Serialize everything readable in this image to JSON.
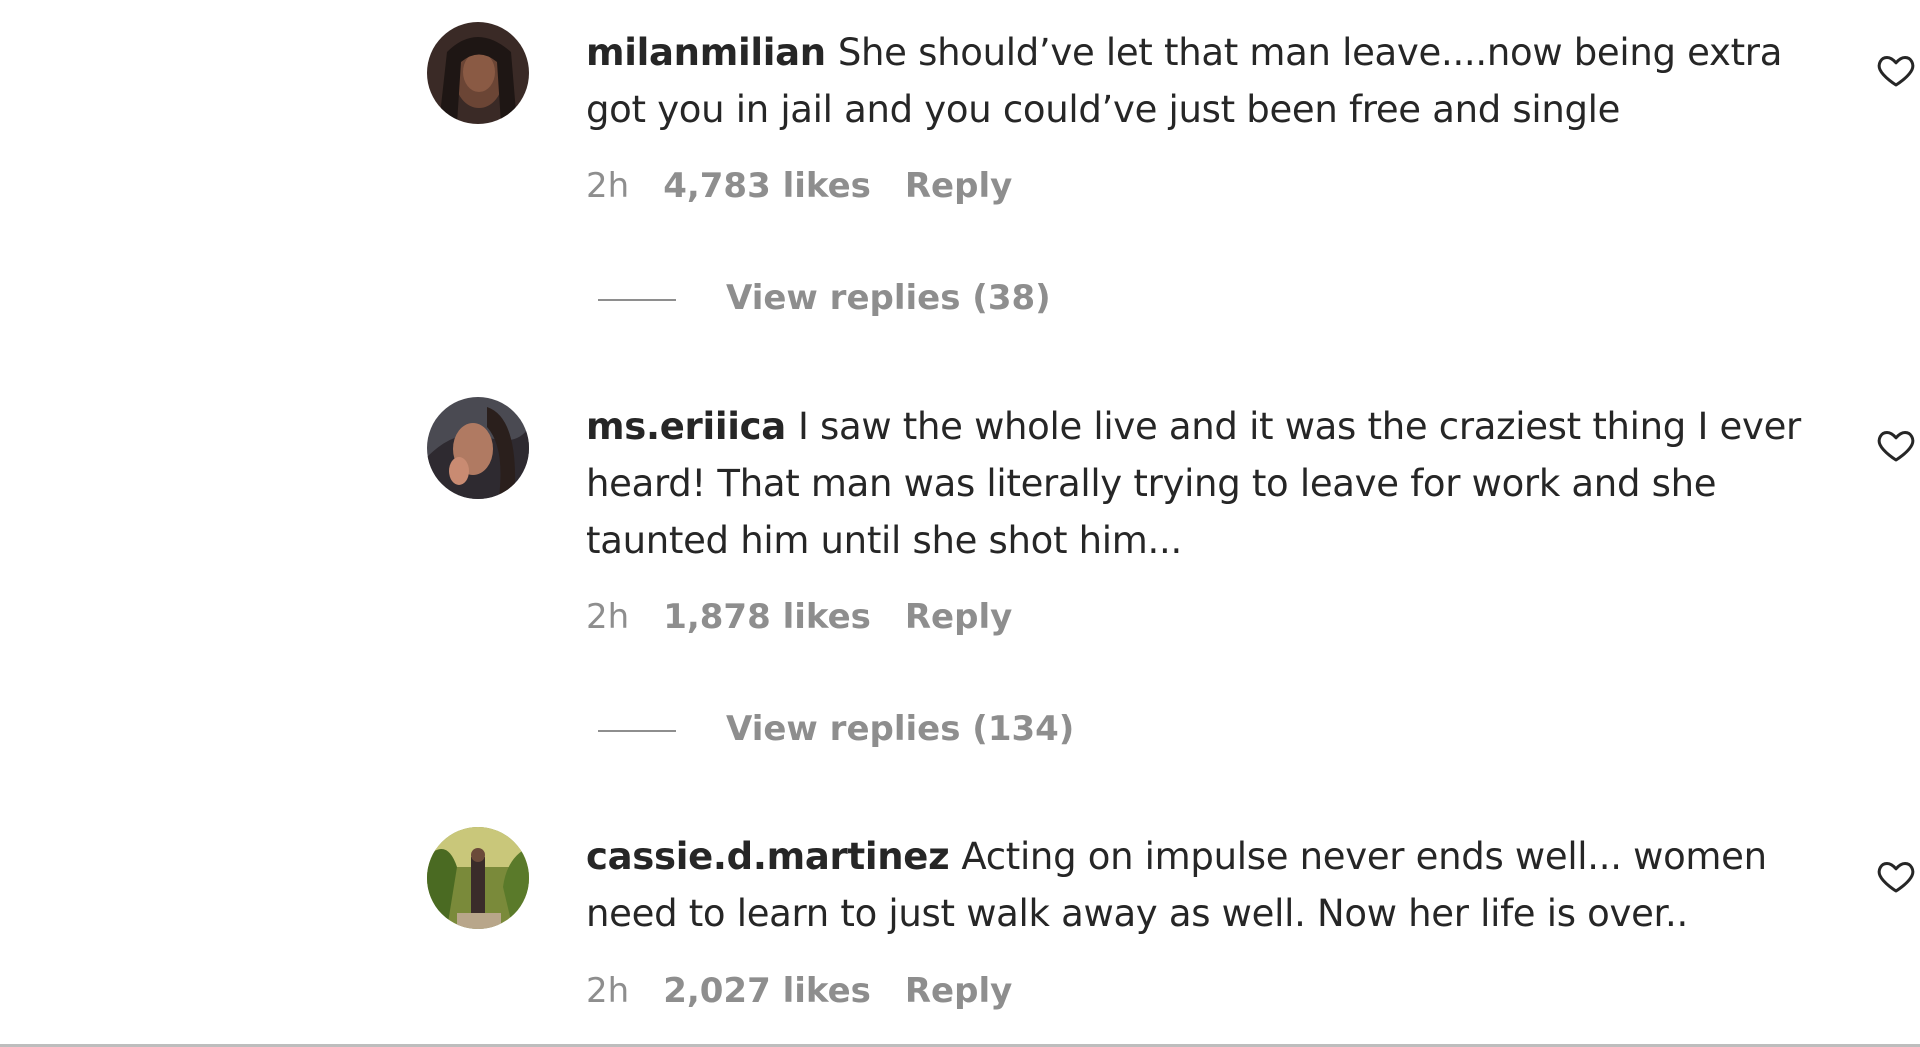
{
  "comments": [
    {
      "username": "milanmilian",
      "text": "She should’ve let that man leave....now being extra got you in jail and you could’ve just been free and single",
      "time": "2h",
      "likes": "4,783 likes",
      "reply": "Reply",
      "view_replies": "View replies (38)"
    },
    {
      "username": "ms.eriiica",
      "text": "I saw the whole live and it was the craziest thing I ever heard! That man was literally trying to leave for work and she taunted him until she shot him...",
      "time": "2h",
      "likes": "1,878 likes",
      "reply": "Reply",
      "view_replies": "View replies (134)"
    },
    {
      "username": "cassie.d.martinez",
      "text": "Acting on impulse never ends well... women need to learn to just walk away as well. Now her life is over..",
      "time": "2h",
      "likes": "2,027 likes",
      "reply": "Reply"
    }
  ]
}
